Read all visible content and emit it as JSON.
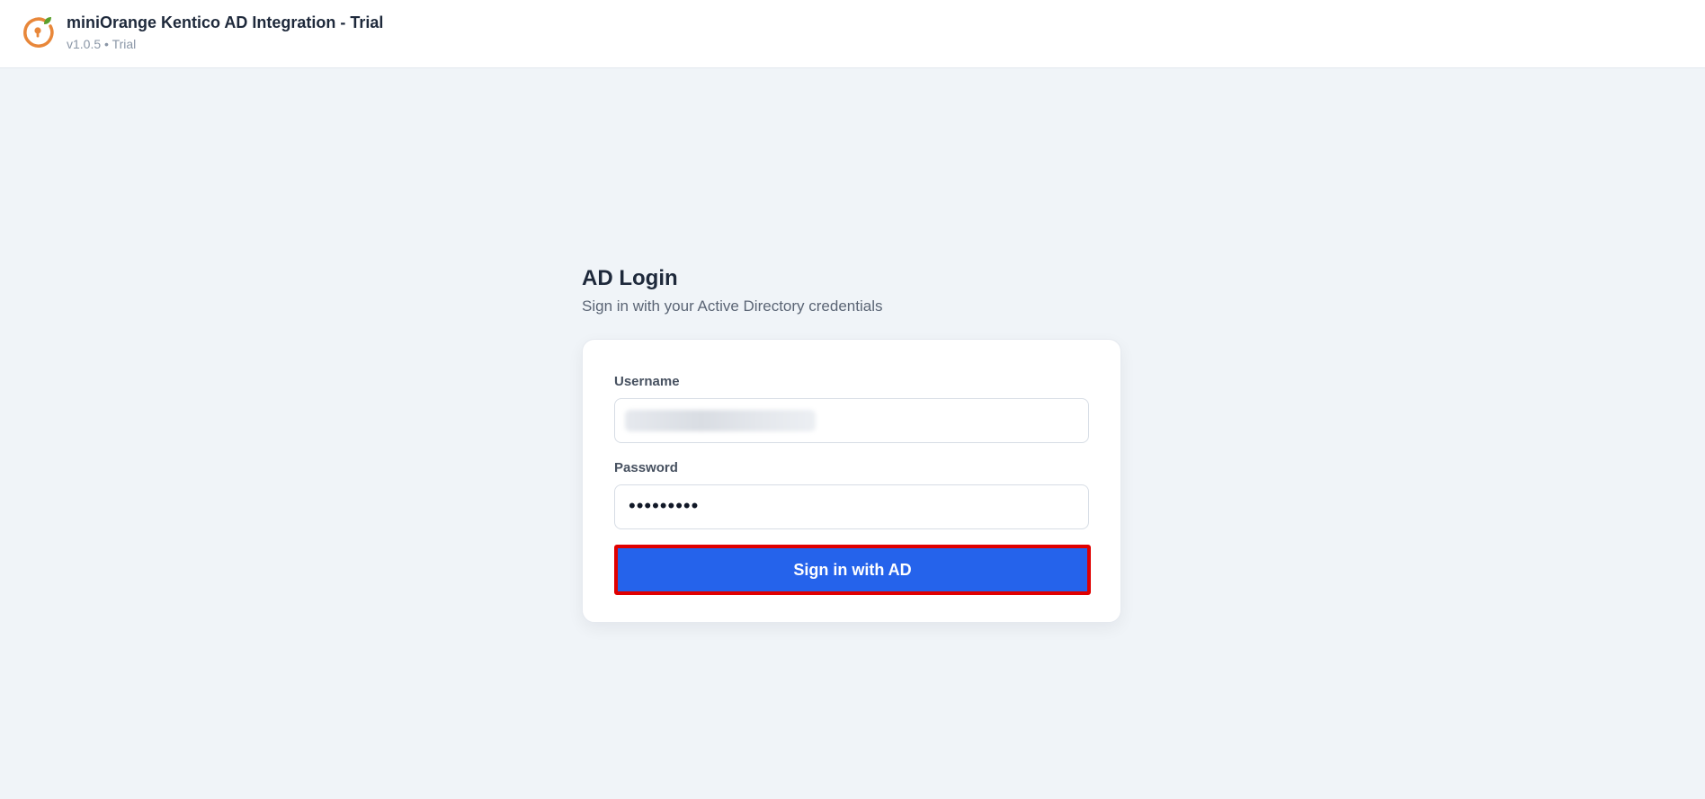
{
  "header": {
    "title": "miniOrange Kentico AD Integration - Trial",
    "subtitle": "v1.0.5 • Trial",
    "logo_icon": "miniorange-logo-icon"
  },
  "login": {
    "heading": "AD Login",
    "subheading": "Sign in with your Active Directory credentials",
    "username_label": "Username",
    "username_value": "",
    "password_label": "Password",
    "password_display": "•••••••••",
    "submit_label": "Sign in with AD"
  },
  "colors": {
    "page_bg": "#f0f4f8",
    "primary_button": "#2563eb",
    "highlight_border": "#e00000",
    "logo_orange": "#e8873a",
    "logo_leaf": "#5aa02c"
  }
}
